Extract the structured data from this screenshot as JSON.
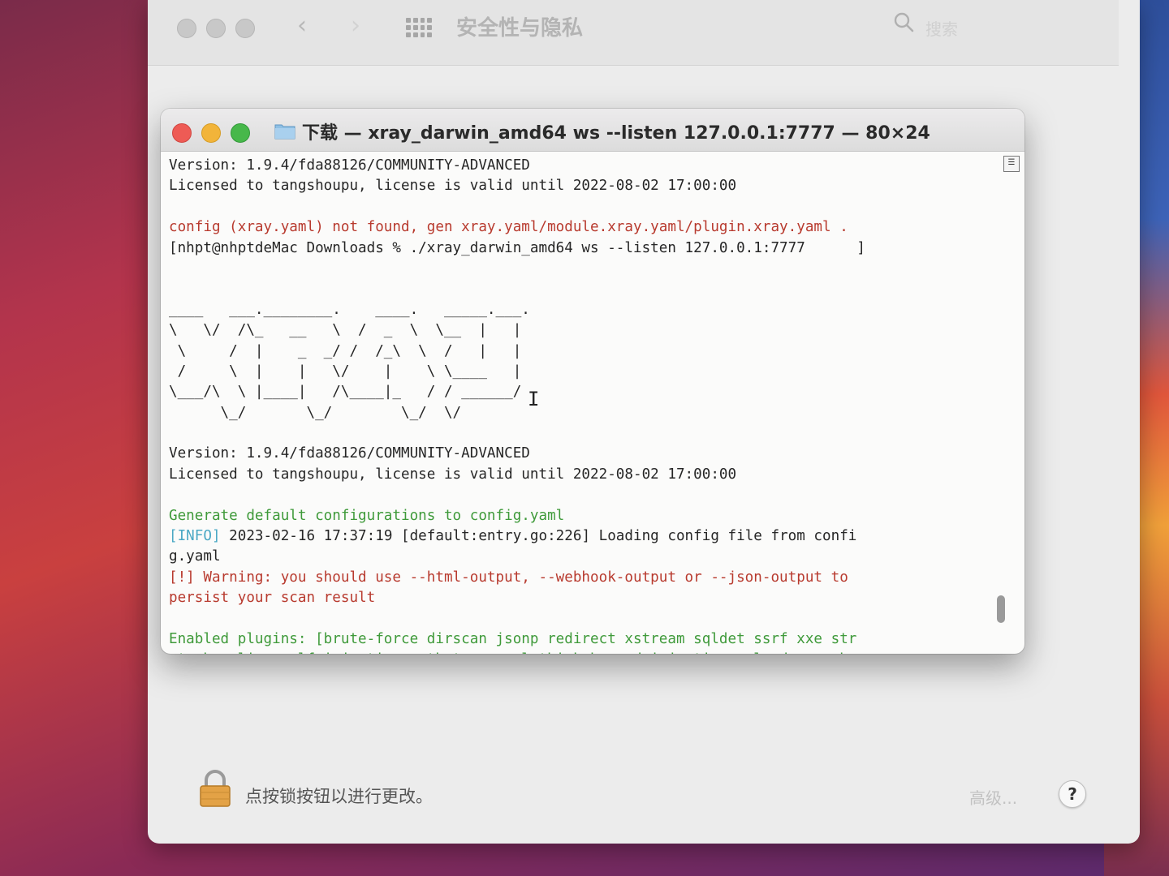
{
  "preferences_window": {
    "title": "安全性与隐私",
    "back": "‹",
    "forward": "›",
    "search_placeholder": "搜索",
    "lock_text": "点按锁按钮以进行更改。",
    "advanced_label": "高级...",
    "help_label": "?"
  },
  "terminal": {
    "title": "下载 — xray_darwin_amd64 ws --listen 127.0.0.1:7777 — 80×24",
    "lines": [
      {
        "text": "Version: 1.9.4/fda88126/COMMUNITY-ADVANCED",
        "color": "default"
      },
      {
        "text": "Licensed to tangshoupu, license is valid until 2022-08-02 17:00:00",
        "color": "default"
      },
      {
        "text": "",
        "color": "default"
      },
      {
        "text": "config (xray.yaml) not found, gen xray.yaml/module.xray.yaml/plugin.xray.yaml .",
        "color": "red"
      },
      {
        "text": "[nhpt@nhptdeMac Downloads % ./xray_darwin_amd64 ws --listen 127.0.0.1:7777      ]",
        "color": "default"
      },
      {
        "text": "",
        "color": "default"
      },
      {
        "text": "",
        "color": "default"
      },
      {
        "text": "____   ___.________.    ____.   _____.___.",
        "color": "default"
      },
      {
        "text": "\\   \\/  /\\_   __   \\  /  _  \\  \\__  |   |",
        "color": "default"
      },
      {
        "text": " \\     /  |    _  _/ /  /_\\  \\  /   |   |",
        "color": "default"
      },
      {
        "text": " /     \\  |    |   \\/    |    \\ \\____   |",
        "color": "default"
      },
      {
        "text": "\\___/\\  \\ |____|   /\\____|_   / / ______/",
        "color": "default"
      },
      {
        "text": "      \\_/       \\_/        \\_/  \\/",
        "color": "default"
      },
      {
        "text": "",
        "color": "default"
      },
      {
        "text": "Version: 1.9.4/fda88126/COMMUNITY-ADVANCED",
        "color": "default"
      },
      {
        "text": "Licensed to tangshoupu, license is valid until 2022-08-02 17:00:00",
        "color": "default"
      },
      {
        "text": "",
        "color": "default"
      },
      {
        "text": "Generate default configurations to config.yaml",
        "color": "green"
      },
      {
        "segments": [
          {
            "text": "[INFO]",
            "color": "cyan"
          },
          {
            "text": " 2023-02-16 17:37:19 [default:entry.go:226] Loading config file from confi",
            "color": "default"
          }
        ]
      },
      {
        "text": "g.yaml",
        "color": "default"
      },
      {
        "text": "[!] Warning: you should use --html-output, --webhook-output or --json-output to",
        "color": "red"
      },
      {
        "text": "persist your scan result",
        "color": "red"
      },
      {
        "text": "",
        "color": "default"
      },
      {
        "text": "Enabled plugins: [brute-force dirscan jsonp redirect xstream sqldet ssrf xxe str",
        "color": "green"
      },
      {
        "text": "uts baseline crlf-injection path-traversal thinkphp cmd-injection upload xss pha",
        "color": "green"
      }
    ],
    "cursor_glyph": "I"
  },
  "colors": {
    "red": "#b83a2e",
    "green": "#3f9a3a",
    "cyan": "#4aa8c4",
    "default": "#262626"
  }
}
